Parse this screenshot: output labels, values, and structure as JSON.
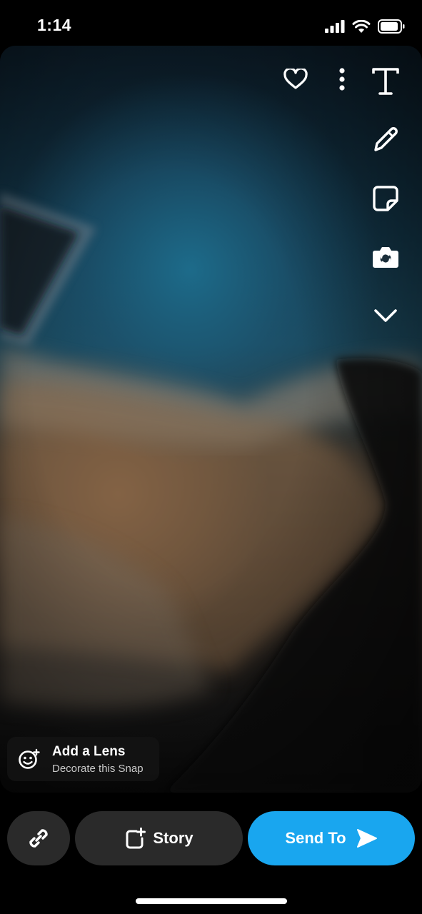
{
  "status_bar": {
    "time": "1:14",
    "icons": [
      "signal-icon",
      "wifi-icon",
      "battery-icon"
    ]
  },
  "top_tools": [
    "heart-icon",
    "more-icon"
  ],
  "side_tools": [
    "text-tool-icon",
    "pencil-icon",
    "sticker-icon",
    "camera-swap-icon",
    "chevron-down-icon"
  ],
  "lens": {
    "title": "Add a Lens",
    "subtitle": "Decorate this Snap",
    "icon": "lens-face-icon"
  },
  "bottom_bar": {
    "link_icon": "link-icon",
    "story_label": "Story",
    "story_icon": "add-story-icon",
    "send_label": "Send To",
    "send_icon": "send-arrow-icon"
  },
  "colors": {
    "send_button": "#19a6ef",
    "dark_button": "#2a2a2a"
  }
}
